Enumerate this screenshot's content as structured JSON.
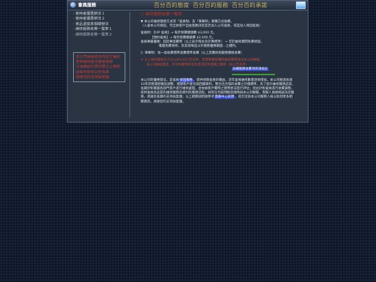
{
  "window": {
    "title": "會員服務",
    "slogans": [
      "百分百的態度",
      "百分百的服務",
      "百分百的承諾"
    ]
  },
  "sidebar": {
    "items": [
      "‧ 使用者優惠辦法１",
      "‧ 使用者優惠辦法２",
      "‧ 商品退換貨相關辦法",
      "‧ 維修服務收費一覽表１",
      "‧ 維修服務收費一覽表２"
    ],
    "notice_lines": [
      "本公司保留修改內容之權利",
      "若有疑問請洽客服專線",
      "凡消費即代表同意以上條款",
      "詳細內容依公告為準",
      "感謝您的支持與愛護"
    ]
  },
  "content": {
    "section_title": "○ 維修服務收費一覽表：",
    "lines": [
      "▼ 本公司維修服務方式有「會員制」及「單筆制」兩種方式收費。",
      "（入會本公司保固，完全依客戶自由意願決定是否加入公司會員，或是加入保固會員）",
      "會員制：【VIP 會員】→ 每年保費繳額費 $3,000 元。",
      "【預約會員】→ 每年保費繳額費 $2,000 元。",
      "會員專屬優惠：固定專案費用（以上表示每台為計算標準） → 可於維修期間免費保固，",
      "電腦免費保修，及其他每品以外服務優惠範圍...之權利。",
      "2. 單筆制：依一般收費標準收費標準收費（以上其實依照服務價格收費）"
    ],
    "red_lines": [
      "※ 以上維修價格及方法以本公司公告為準，若需要瞭解實際維修費用請洽本公司專線，",
      "本公司聯絡電話，另可依實際狀況及需求提供相關之服務（依公告為準）"
    ],
    "red_link": "詳細服務收費項目請按此",
    "para_start": "本公司的優惠辦法，是會員",
    "para_link": "保固服務",
    "para_mid": "，提供保障會員的權益，近年會員維修數量逐漸增加，本公司經過長達10年的營運經驗及調整，相關客戶意見與回饋資料，整合出合理的收費之計價標準，為了提升維修服務品質，長期針對電腦各部門客戶進行維修處理，並依據客戶實際之使用狀況進行評估；因此針對會員進行收費調整，提供會員高品質的維修服務及便利的服務流程，如有任何疑問歡迎隨時與本公司聯繫，客服人員將竭誠為您服務，感謝您長期的支持與愛護；以上相關說明請參考",
    "para_link2": "客服中心說明",
    "para_end": "，或可洽詢本公司服務人員以取得更多相關資訊，謝謝您的支持與愛護。"
  },
  "colors": {
    "background": "#10192a",
    "window": "#2a3443",
    "slogan": "#c9b25c",
    "warning": "#d83a2e",
    "highlight": "#2f44c8"
  },
  "icons": {
    "title": "globe-icon",
    "corner": "monitor-icon"
  }
}
